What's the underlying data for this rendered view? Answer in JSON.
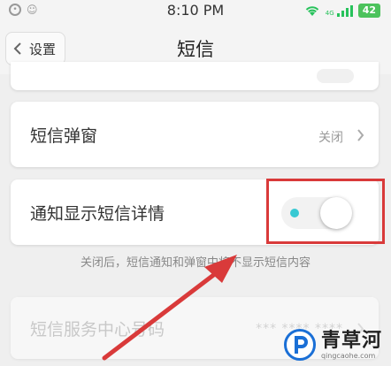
{
  "status_bar": {
    "time": "8:10 PM",
    "battery": "42",
    "signal_label": "4G",
    "left_icons": [
      "notification-icon",
      "contacts-icon"
    ],
    "right_icons": [
      "wifi-icon",
      "signal-icon",
      "battery-icon"
    ]
  },
  "nav": {
    "back_label": "设置",
    "title": "短信"
  },
  "settings": {
    "popup": {
      "label": "短信弹窗",
      "value": "关闭"
    },
    "notify_detail": {
      "label": "通知显示短信详情",
      "toggle_on": false
    },
    "hint": "关闭后，短信通知和弹窗中将不显示短信内容",
    "service_center": {
      "label": "短信服务中心号码",
      "value": "*** **** ****"
    }
  },
  "annotation": {
    "highlight_color": "#d93a3a"
  },
  "watermark": {
    "name": "青草河",
    "url": "qingcaohe.com",
    "logo_color": "#1a6fd6"
  }
}
